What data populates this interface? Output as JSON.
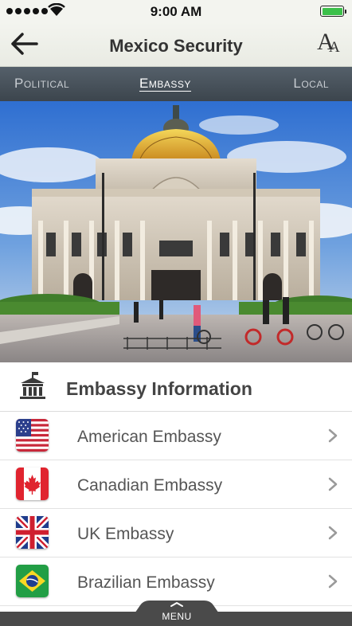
{
  "status_bar": {
    "time": "9:00 AM",
    "battery_level": 1.0
  },
  "header": {
    "title": "Mexico Security"
  },
  "tabs": [
    {
      "label": "Political",
      "active": false
    },
    {
      "label": "Embassy",
      "active": true
    },
    {
      "label": "Local",
      "active": false
    }
  ],
  "section": {
    "title": "Embassy Information"
  },
  "embassies": [
    {
      "label": "American Embassy",
      "flag": "us-flag-icon"
    },
    {
      "label": "Canadian Embassy",
      "flag": "canada-flag-icon"
    },
    {
      "label": "UK Embassy",
      "flag": "uk-flag-icon"
    },
    {
      "label": "Brazilian Embassy",
      "flag": "brazil-flag-icon"
    }
  ],
  "menu": {
    "label": "MENU"
  },
  "colors": {
    "tab_bar": "#3c454d",
    "battery": "#3cc04a",
    "menu_bar": "#4a4a4a"
  }
}
